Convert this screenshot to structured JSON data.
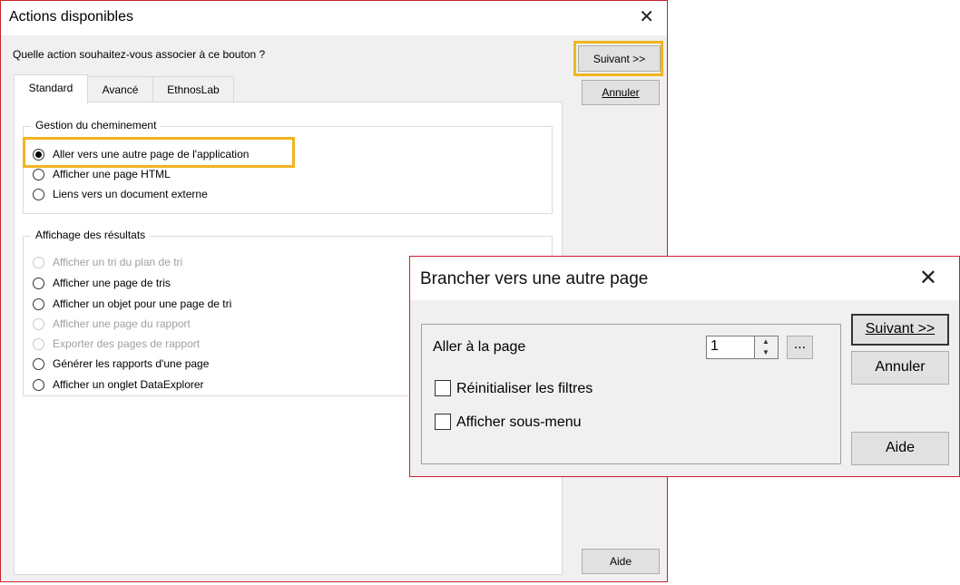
{
  "dialog1": {
    "title": "Actions disponibles",
    "close_glyph": "✕",
    "question": "Quelle action souhaitez-vous associer à ce bouton ?",
    "tabs": [
      {
        "label": "Standard",
        "active": true
      },
      {
        "label": "Avancé",
        "active": false
      },
      {
        "label": "EthnosLab",
        "active": false
      }
    ],
    "group_navigation": {
      "label": "Gestion du cheminement",
      "options": [
        {
          "label": "Aller vers une autre page de l'application",
          "checked": true,
          "enabled": true
        },
        {
          "label": "Afficher une page HTML",
          "checked": false,
          "enabled": true
        },
        {
          "label": "Liens vers un document externe",
          "checked": false,
          "enabled": true
        }
      ]
    },
    "group_results": {
      "label": "Affichage des résultats",
      "options": [
        {
          "label": "Afficher un tri du plan de tri",
          "checked": false,
          "enabled": false
        },
        {
          "label": "Afficher une page de tris",
          "checked": false,
          "enabled": true
        },
        {
          "label": "Afficher un objet pour une page de tri",
          "checked": false,
          "enabled": true
        },
        {
          "label": "Afficher une page du rapport",
          "checked": false,
          "enabled": false
        },
        {
          "label": "Exporter des pages de rapport",
          "checked": false,
          "enabled": false
        },
        {
          "label": "Générer les rapports d'une page",
          "checked": false,
          "enabled": true
        },
        {
          "label": "Afficher un onglet DataExplorer",
          "checked": false,
          "enabled": true
        }
      ]
    },
    "buttons": {
      "next": "Suivant >>",
      "cancel": "Annuler",
      "help": "Aide"
    },
    "highlight_color": "#f1b421"
  },
  "dialog2": {
    "title": "Brancher vers une autre page",
    "close_glyph": "✕",
    "goto_label": "Aller à la page",
    "page_value": "1",
    "spin_up": "▲",
    "spin_down": "▼",
    "browse_label": "...",
    "reset_filters": {
      "label": "Réinitialiser les filtres",
      "checked": false
    },
    "show_submenu": {
      "label": "Afficher sous-menu",
      "checked": false
    },
    "buttons": {
      "next": "Suivant >>",
      "cancel": "Annuler",
      "help": "Aide"
    }
  },
  "colors": {
    "window_border": "#c8232b",
    "highlight": "#f1b421",
    "dialog_bg": "#f0f0f0",
    "button_bg": "#e1e1e1"
  }
}
